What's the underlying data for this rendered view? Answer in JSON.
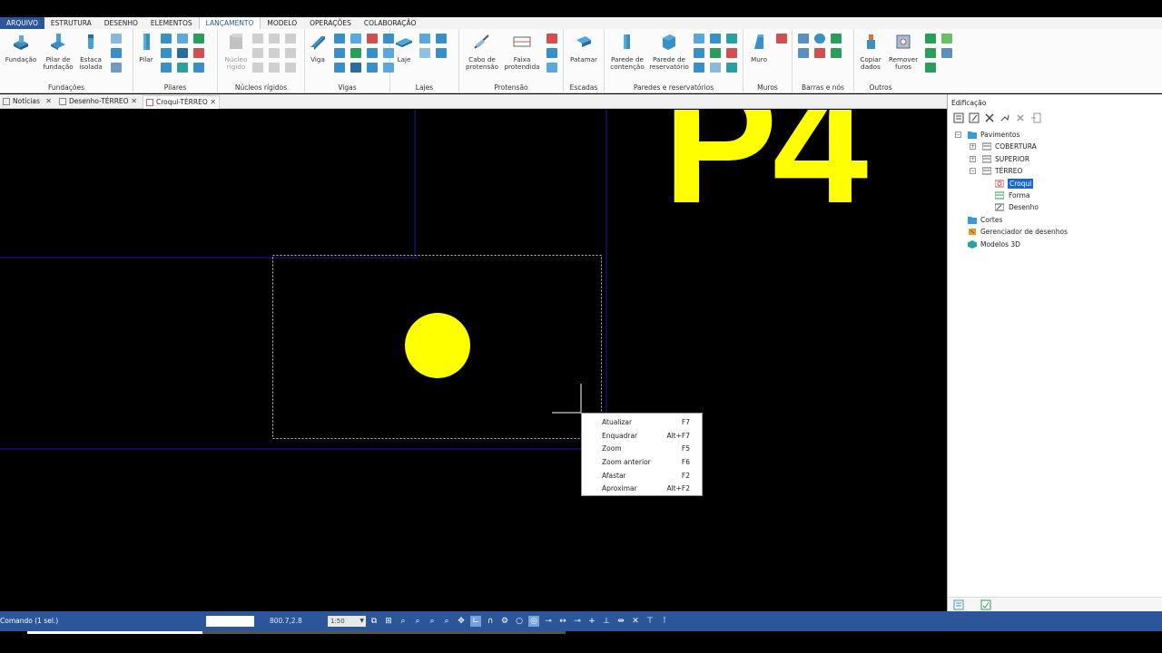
{
  "menu": {
    "items": [
      "ARQUIVO",
      "ESTRUTURA",
      "DESENHO",
      "ELEMENTOS",
      "LANÇAMENTO",
      "MODELO",
      "OPERAÇÕES",
      "COLABORAÇÃO"
    ],
    "active": "LANÇAMENTO"
  },
  "ribbon": {
    "fundacoes": {
      "title": "Fundações",
      "btn1": "Fundação",
      "btn2_l1": "Pilar de",
      "btn2_l2": "fundação",
      "btn3_l1": "Estaca",
      "btn3_l2": "isolada"
    },
    "pilares": {
      "title": "Pilares",
      "btn1": "Pilar"
    },
    "nucleos": {
      "title": "Núcleos rígidos",
      "btn1_l1": "Núcleo",
      "btn1_l2": "rígido"
    },
    "vigas": {
      "title": "Vigas",
      "btn1": "Viga"
    },
    "lajes": {
      "title": "Lajes",
      "btn1": "Laje"
    },
    "protensao": {
      "title": "Protensão",
      "btn1_l1": "Cabo de",
      "btn1_l2": "protensão",
      "btn2_l1": "Faixa",
      "btn2_l2": "protendida"
    },
    "escadas": {
      "title": "Escadas",
      "btn1": "Patamar"
    },
    "paredes": {
      "title": "Paredes e reservatórios",
      "btn1_l1": "Parede de",
      "btn1_l2": "contenção",
      "btn2_l1": "Parede de",
      "btn2_l2": "reservatório"
    },
    "muros": {
      "title": "Muros",
      "btn1": "Muro"
    },
    "barras": {
      "title": "Barras e nós"
    },
    "outros": {
      "title": "Outros",
      "btn1_l1": "Copiar",
      "btn1_l2": "dados",
      "btn2_l1": "Remover",
      "btn2_l2": "furos"
    }
  },
  "tabs": [
    {
      "label": "Notícias"
    },
    {
      "label": "Desenho-TÉRREO"
    },
    {
      "label": "Croqui-TÉRREO"
    }
  ],
  "canvas": {
    "big_label": "P4"
  },
  "context_menu": [
    {
      "label": "Atualizar",
      "shortcut": "F7"
    },
    {
      "label": "Enquadrar",
      "shortcut": "Alt+F7"
    },
    {
      "label": "Zoom",
      "shortcut": "F5"
    },
    {
      "label": "Zoom anterior",
      "shortcut": "F6"
    },
    {
      "label": "Afastar",
      "shortcut": "F2"
    },
    {
      "label": "Aproximar",
      "shortcut": "Alt+F2"
    }
  ],
  "panel": {
    "title": "Edificação",
    "tree": {
      "pavimentos": "Pavimentos",
      "cobertura": "COBERTURA",
      "superior": "SUPERIOR",
      "terreo": "TÉRREO",
      "croqui": "Croqui",
      "forma": "Forma",
      "desenho": "Desenho",
      "cortes": "Cortes",
      "gerenciador": "Gerenciador de desenhos",
      "modelos": "Modelos 3D"
    }
  },
  "status": {
    "command": "Comando (1 sel.)",
    "coords": "800.7,2.8",
    "scale": "1:50"
  },
  "colors": {
    "accent": "#2b579a",
    "yellow": "#ffff00",
    "selection": "#1967d2"
  }
}
